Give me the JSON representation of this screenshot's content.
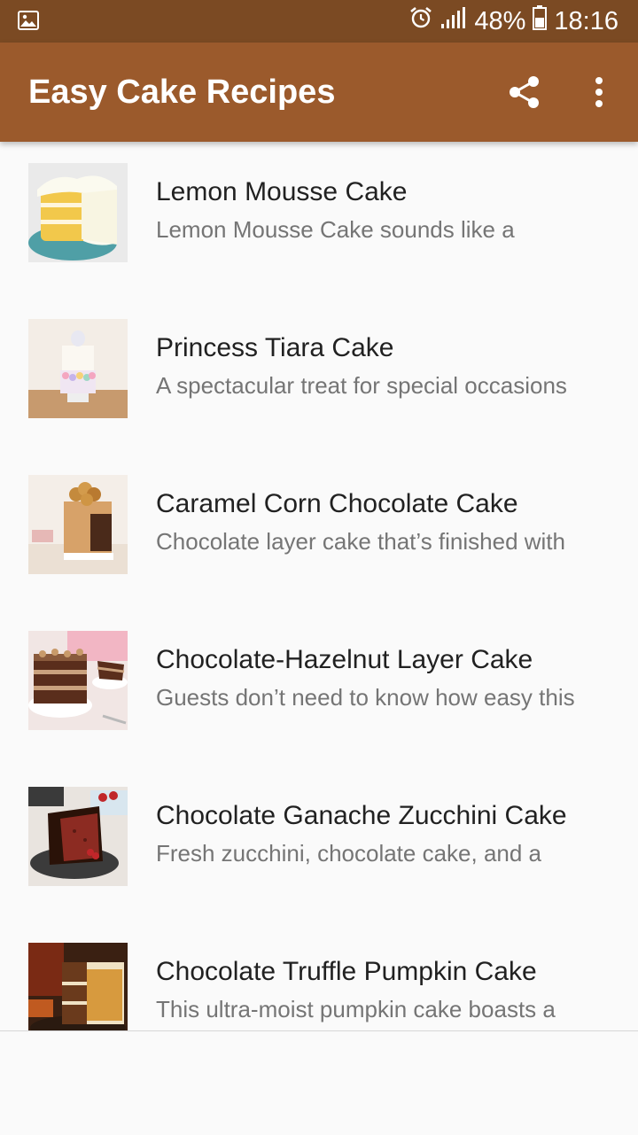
{
  "status_bar": {
    "battery_percent": "48%",
    "time": "18:16"
  },
  "app_bar": {
    "title": "Easy Cake Recipes",
    "share_icon": "share-icon",
    "more_icon": "more-vert-icon"
  },
  "recipes": [
    {
      "title": "Lemon Mousse Cake",
      "description": "Lemon Mousse Cake sounds like a"
    },
    {
      "title": "Princess Tiara Cake",
      "description": "A spectacular treat for special occasions"
    },
    {
      "title": "Caramel Corn Chocolate Cake",
      "description": "Chocolate layer cake that’s finished with"
    },
    {
      "title": "Chocolate-Hazelnut Layer Cake",
      "description": "Guests don’t need to know how easy this"
    },
    {
      "title": "Chocolate Ganache Zucchini Cake",
      "description": "Fresh zucchini, chocolate cake, and a"
    },
    {
      "title": "Chocolate Truffle Pumpkin Cake",
      "description": "This ultra-moist pumpkin cake boasts a"
    }
  ],
  "colors": {
    "status_bar": "#7b4a23",
    "app_bar": "#9b5a2c",
    "background": "#fafafa"
  }
}
